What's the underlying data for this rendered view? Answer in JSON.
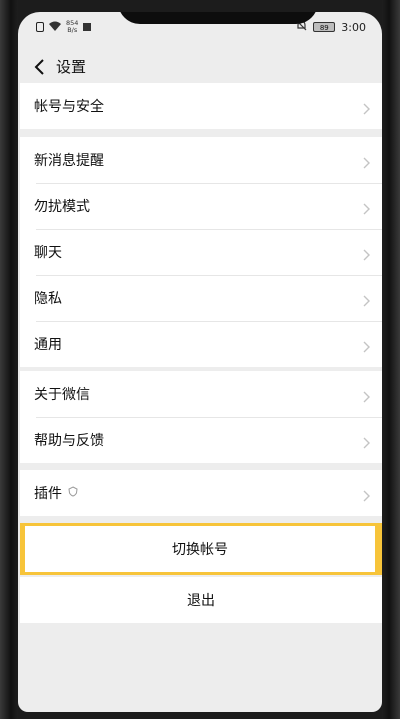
{
  "status_bar": {
    "speed_value": "854",
    "speed_unit": "B/s",
    "battery": "89",
    "time": "3:00"
  },
  "header": {
    "title": "设置"
  },
  "groups": [
    {
      "items": [
        {
          "label": "帐号与安全"
        }
      ]
    },
    {
      "items": [
        {
          "label": "新消息提醒"
        },
        {
          "label": "勿扰模式"
        },
        {
          "label": "聊天"
        },
        {
          "label": "隐私"
        },
        {
          "label": "通用"
        }
      ]
    },
    {
      "items": [
        {
          "label": "关于微信"
        },
        {
          "label": "帮助与反馈"
        }
      ]
    },
    {
      "items": [
        {
          "label": "插件"
        }
      ]
    }
  ],
  "actions": {
    "switch_account": "切换帐号",
    "logout": "退出"
  },
  "colors": {
    "background": "#ededed",
    "highlight": "#f7c43a"
  }
}
